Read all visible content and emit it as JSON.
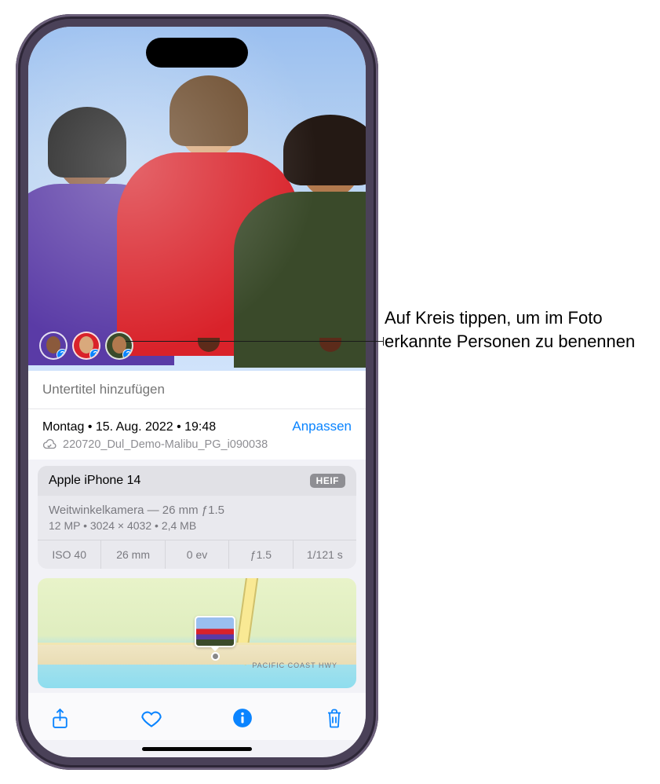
{
  "caption": {
    "placeholder": "Untertitel hinzufügen"
  },
  "meta": {
    "date": "Montag • 15. Aug. 2022 • 19:48",
    "adjust": "Anpassen",
    "filename": "220720_Dul_Demo-Malibu_PG_i090038"
  },
  "camera": {
    "device": "Apple iPhone 14",
    "format": "HEIF",
    "lens": "Weitwinkelkamera — 26 mm ƒ1.5",
    "specs": "12 MP  •  3024 × 4032  •  2,4 MB",
    "exif": {
      "iso": "ISO 40",
      "focal": "26 mm",
      "ev": "0 ev",
      "ap": "ƒ1.5",
      "shutter": "1/121 s"
    }
  },
  "map": {
    "highway": "PACIFIC COAST HWY"
  },
  "callout": {
    "text": "Auf Kreis tippen, um im Foto erkannte Personen zu benennen"
  },
  "people": {
    "count": 3
  }
}
